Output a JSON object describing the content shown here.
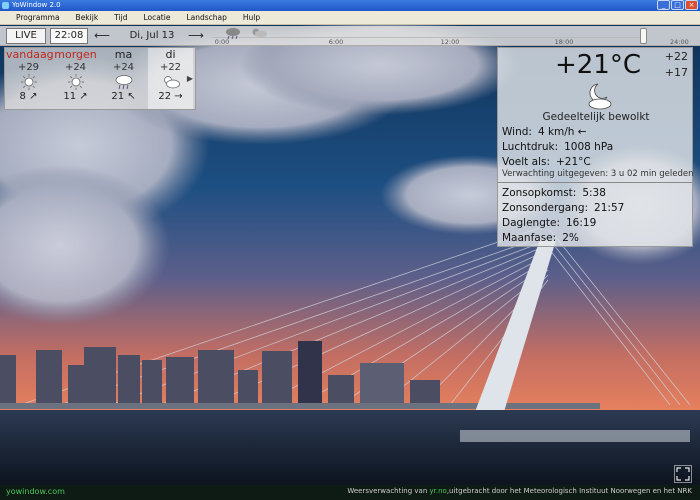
{
  "window": {
    "title": "YoWindow 2.0"
  },
  "menu": [
    "Programma",
    "Bekijk",
    "Tijd",
    "Locatie",
    "Landschap",
    "Hulp"
  ],
  "toolbar": {
    "live_label": "LIVE",
    "time": "22:08",
    "prev_arrow": "⟵",
    "date": "Di, Jul 13",
    "next_arrow": "⟶",
    "timeline_ticks": [
      "0:00",
      "6:00",
      "12:00",
      "18:00",
      "24:00"
    ]
  },
  "forecast": {
    "days": [
      {
        "name": "vandaag",
        "high": "+29",
        "low": "8",
        "icon": "sun-icon",
        "wind": "↗"
      },
      {
        "name": "morgen",
        "high": "+24",
        "low": "11",
        "icon": "sun-icon",
        "wind": "↗"
      },
      {
        "name": "ma",
        "high": "+24",
        "low": "21",
        "icon": "rain-cloud-icon",
        "wind": "↖"
      },
      {
        "name": "di",
        "high": "+22",
        "low": "22",
        "icon": "partly-cloudy-icon",
        "wind": "→"
      }
    ],
    "more_arrow": "▶"
  },
  "current": {
    "temperature": "+21°C",
    "high": "+22",
    "low": "+17",
    "condition": "Gedeeltelijk bewolkt",
    "wind_label": "Wind:",
    "wind_value": "4 km/h ←",
    "pressure_label": "Luchtdruk:",
    "pressure_value": "1008 hPa",
    "feels_label": "Voelt als:",
    "feels_value": "+21°C",
    "issued": "Verwachting uitgegeven:  3 u 02 min geleden",
    "sunrise_label": "Zonsopkomst:",
    "sunrise_value": "5:38",
    "sunset_label": "Zonsondergang:",
    "sunset_value": "21:57",
    "daylength_label": "Daglengte:",
    "daylength_value": "16:19",
    "moon_label": "Maanfase:",
    "moon_value": "2%"
  },
  "status": {
    "brand": "yowindow.com",
    "credit_prefix": "Weersverwachting van ",
    "credit_source": "yr.no",
    "credit_suffix": ",uitgebracht door het Meteorologisch Instituut Noorwegen en het NRK"
  },
  "colors": {
    "today": "#c0281c",
    "brand": "#4cc85c",
    "sky_top": "#123a66",
    "sky_bottom": "#e4795c"
  }
}
